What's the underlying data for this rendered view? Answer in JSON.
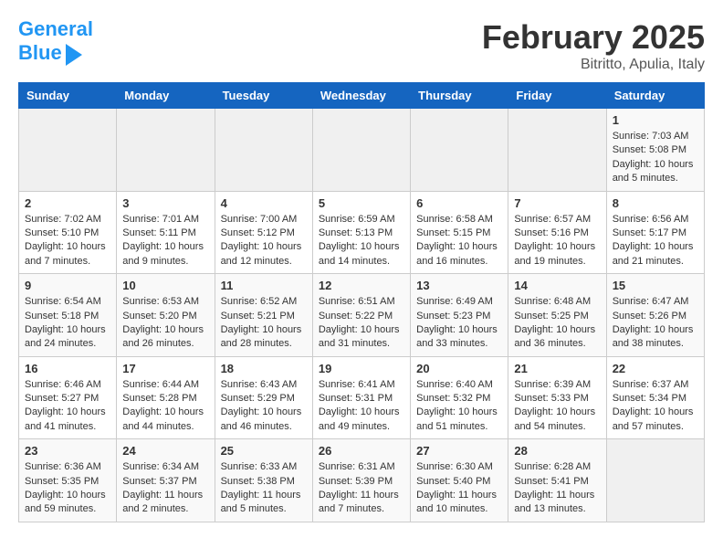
{
  "header": {
    "logo_line1": "General",
    "logo_line2": "Blue",
    "month": "February 2025",
    "location": "Bitritto, Apulia, Italy"
  },
  "days_of_week": [
    "Sunday",
    "Monday",
    "Tuesday",
    "Wednesday",
    "Thursday",
    "Friday",
    "Saturday"
  ],
  "weeks": [
    [
      {
        "day": "",
        "content": ""
      },
      {
        "day": "",
        "content": ""
      },
      {
        "day": "",
        "content": ""
      },
      {
        "day": "",
        "content": ""
      },
      {
        "day": "",
        "content": ""
      },
      {
        "day": "",
        "content": ""
      },
      {
        "day": "1",
        "content": "Sunrise: 7:03 AM\nSunset: 5:08 PM\nDaylight: 10 hours\nand 5 minutes."
      }
    ],
    [
      {
        "day": "2",
        "content": "Sunrise: 7:02 AM\nSunset: 5:10 PM\nDaylight: 10 hours\nand 7 minutes."
      },
      {
        "day": "3",
        "content": "Sunrise: 7:01 AM\nSunset: 5:11 PM\nDaylight: 10 hours\nand 9 minutes."
      },
      {
        "day": "4",
        "content": "Sunrise: 7:00 AM\nSunset: 5:12 PM\nDaylight: 10 hours\nand 12 minutes."
      },
      {
        "day": "5",
        "content": "Sunrise: 6:59 AM\nSunset: 5:13 PM\nDaylight: 10 hours\nand 14 minutes."
      },
      {
        "day": "6",
        "content": "Sunrise: 6:58 AM\nSunset: 5:15 PM\nDaylight: 10 hours\nand 16 minutes."
      },
      {
        "day": "7",
        "content": "Sunrise: 6:57 AM\nSunset: 5:16 PM\nDaylight: 10 hours\nand 19 minutes."
      },
      {
        "day": "8",
        "content": "Sunrise: 6:56 AM\nSunset: 5:17 PM\nDaylight: 10 hours\nand 21 minutes."
      }
    ],
    [
      {
        "day": "9",
        "content": "Sunrise: 6:54 AM\nSunset: 5:18 PM\nDaylight: 10 hours\nand 24 minutes."
      },
      {
        "day": "10",
        "content": "Sunrise: 6:53 AM\nSunset: 5:20 PM\nDaylight: 10 hours\nand 26 minutes."
      },
      {
        "day": "11",
        "content": "Sunrise: 6:52 AM\nSunset: 5:21 PM\nDaylight: 10 hours\nand 28 minutes."
      },
      {
        "day": "12",
        "content": "Sunrise: 6:51 AM\nSunset: 5:22 PM\nDaylight: 10 hours\nand 31 minutes."
      },
      {
        "day": "13",
        "content": "Sunrise: 6:49 AM\nSunset: 5:23 PM\nDaylight: 10 hours\nand 33 minutes."
      },
      {
        "day": "14",
        "content": "Sunrise: 6:48 AM\nSunset: 5:25 PM\nDaylight: 10 hours\nand 36 minutes."
      },
      {
        "day": "15",
        "content": "Sunrise: 6:47 AM\nSunset: 5:26 PM\nDaylight: 10 hours\nand 38 minutes."
      }
    ],
    [
      {
        "day": "16",
        "content": "Sunrise: 6:46 AM\nSunset: 5:27 PM\nDaylight: 10 hours\nand 41 minutes."
      },
      {
        "day": "17",
        "content": "Sunrise: 6:44 AM\nSunset: 5:28 PM\nDaylight: 10 hours\nand 44 minutes."
      },
      {
        "day": "18",
        "content": "Sunrise: 6:43 AM\nSunset: 5:29 PM\nDaylight: 10 hours\nand 46 minutes."
      },
      {
        "day": "19",
        "content": "Sunrise: 6:41 AM\nSunset: 5:31 PM\nDaylight: 10 hours\nand 49 minutes."
      },
      {
        "day": "20",
        "content": "Sunrise: 6:40 AM\nSunset: 5:32 PM\nDaylight: 10 hours\nand 51 minutes."
      },
      {
        "day": "21",
        "content": "Sunrise: 6:39 AM\nSunset: 5:33 PM\nDaylight: 10 hours\nand 54 minutes."
      },
      {
        "day": "22",
        "content": "Sunrise: 6:37 AM\nSunset: 5:34 PM\nDaylight: 10 hours\nand 57 minutes."
      }
    ],
    [
      {
        "day": "23",
        "content": "Sunrise: 6:36 AM\nSunset: 5:35 PM\nDaylight: 10 hours\nand 59 minutes."
      },
      {
        "day": "24",
        "content": "Sunrise: 6:34 AM\nSunset: 5:37 PM\nDaylight: 11 hours\nand 2 minutes."
      },
      {
        "day": "25",
        "content": "Sunrise: 6:33 AM\nSunset: 5:38 PM\nDaylight: 11 hours\nand 5 minutes."
      },
      {
        "day": "26",
        "content": "Sunrise: 6:31 AM\nSunset: 5:39 PM\nDaylight: 11 hours\nand 7 minutes."
      },
      {
        "day": "27",
        "content": "Sunrise: 6:30 AM\nSunset: 5:40 PM\nDaylight: 11 hours\nand 10 minutes."
      },
      {
        "day": "28",
        "content": "Sunrise: 6:28 AM\nSunset: 5:41 PM\nDaylight: 11 hours\nand 13 minutes."
      },
      {
        "day": "",
        "content": ""
      }
    ]
  ]
}
